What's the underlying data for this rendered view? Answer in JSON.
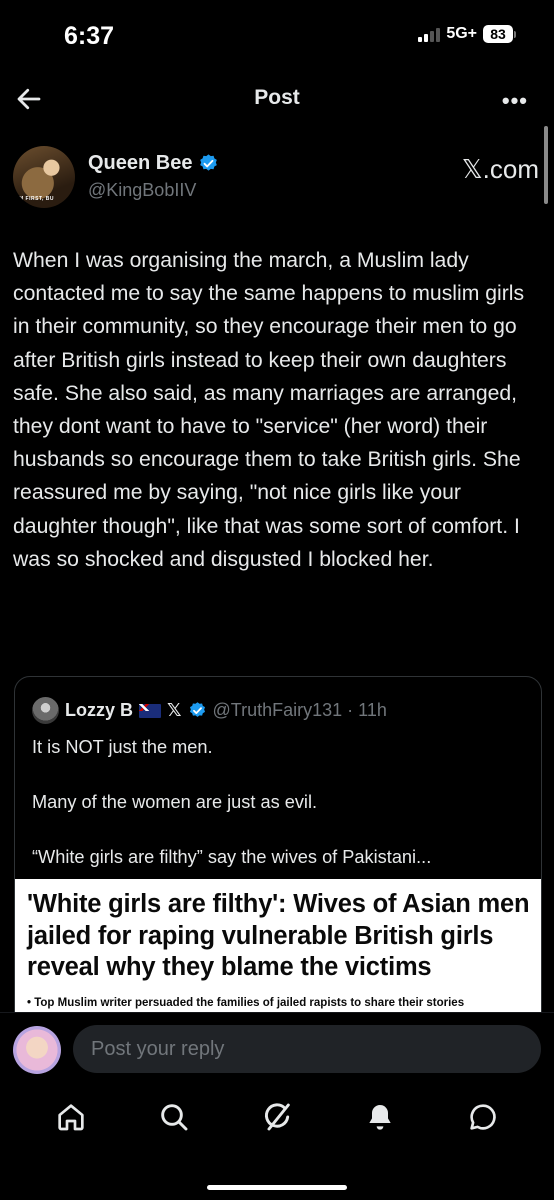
{
  "status_bar": {
    "time": "6:37",
    "network": "5G+",
    "battery": "83"
  },
  "nav": {
    "title": "Post",
    "back_icon": "back-arrow-icon",
    "more_icon": "more-dots-icon",
    "more_label": "•••"
  },
  "post": {
    "author_name": "Queen Bee",
    "author_handle": "@KingBobIIV",
    "avatar_caption": "M FIRST, BU",
    "watermark": "𝕏.com",
    "body": "When I was organising the march, a Muslim lady contacted me to say the same happens to muslim girls in their community, so they encourage their men to go after British girls instead to keep their own daughters safe.  She also said, as many marriages are arranged, they dont want to have to \"service\" (her word) their husbands so encourage them to take British girls.  She reassured me by saying, \"not nice girls like your daughter though\", like that was some sort of comfort. I was so shocked and disgusted I blocked her."
  },
  "quote": {
    "name": "Lozzy B",
    "x_badge": "𝕏",
    "handle_time": "@TruthFairy131 · 11h",
    "lines": [
      "It is NOT just the men.",
      "Many of the women are just as evil.",
      "“White girls are filthy” say the wives of Pakistani..."
    ],
    "image_headline": "'White girls are filthy': Wives of Asian men jailed for raping vulnerable British girls reveal why they blame the victims",
    "image_bullet": "•  Top Muslim writer persuaded the families of jailed rapists to share their stories"
  },
  "reply": {
    "placeholder": "Post your reply"
  },
  "tab_bar": {
    "icons": [
      "home-icon",
      "search-icon",
      "grok-icon",
      "notifications-icon",
      "messages-icon"
    ]
  },
  "colors": {
    "background": "#000000",
    "text": "#e7e9ea",
    "secondary": "#71767b",
    "verified": "#1d9bf0",
    "border": "#2f3336"
  }
}
